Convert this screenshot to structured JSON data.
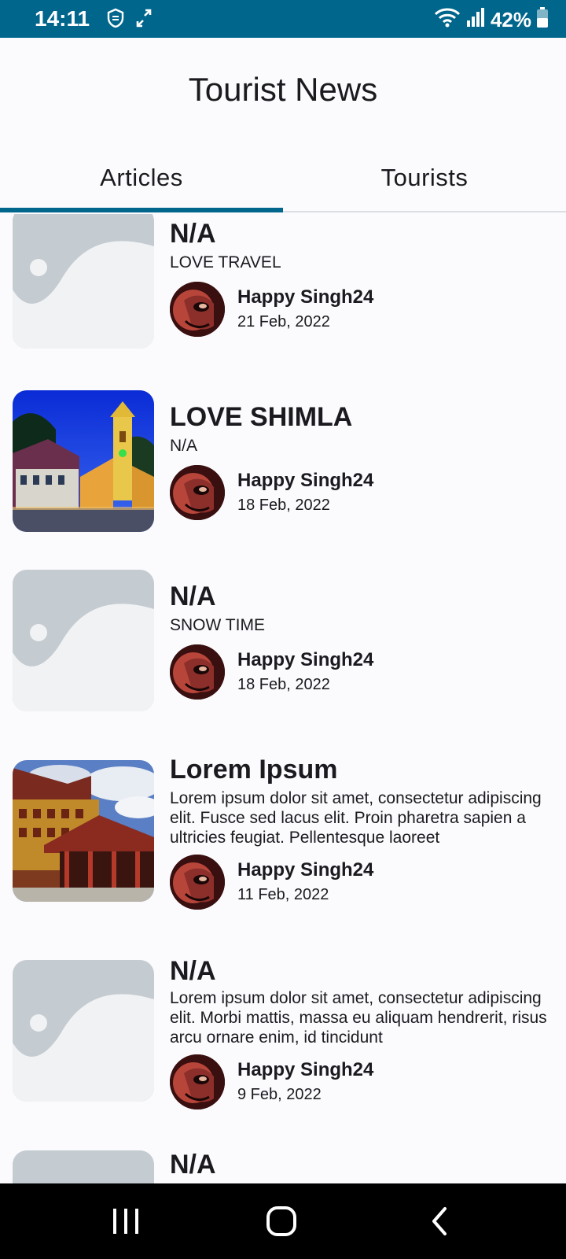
{
  "status_bar": {
    "time": "14:11",
    "battery": "42%",
    "color": "#00668c"
  },
  "app": {
    "title": "Tourist News"
  },
  "tabs": [
    {
      "label": "Articles",
      "active": true
    },
    {
      "label": "Tourists",
      "active": false
    }
  ],
  "articles": [
    {
      "title": "N/A",
      "subtitle": "LOVE TRAVEL",
      "author": "Happy Singh24",
      "date": "21 Feb, 2022",
      "image": "placeholder-image-icon"
    },
    {
      "title": "LOVE SHIMLA",
      "subtitle": "N/A",
      "author": "Happy Singh24",
      "date": "18 Feb, 2022",
      "image": "church-photo"
    },
    {
      "title": "N/A",
      "subtitle": "SNOW TIME",
      "author": "Happy Singh24",
      "date": "18 Feb, 2022",
      "image": "placeholder-image-icon"
    },
    {
      "title": "Lorem Ipsum",
      "subtitle": "Lorem ipsum dolor sit amet, consectetur adipiscing elit. Fusce sed lacus elit. Proin pharetra sapien a ultricies feugiat. Pellentesque laoreet",
      "author": "Happy Singh24",
      "date": "11 Feb, 2022",
      "image": "temple-photo"
    },
    {
      "title": "N/A",
      "subtitle": "Lorem ipsum dolor sit amet, consectetur adipiscing elit. Morbi mattis, massa eu aliquam hendrerit, risus arcu ornare enim, id tincidunt",
      "author": "Happy Singh24",
      "date": "9 Feb, 2022",
      "image": "placeholder-image-icon"
    },
    {
      "title": "N/A",
      "image": "placeholder-image-icon"
    }
  ],
  "nav": {
    "recents": "recents-icon",
    "home": "home-icon",
    "back": "back-icon"
  }
}
